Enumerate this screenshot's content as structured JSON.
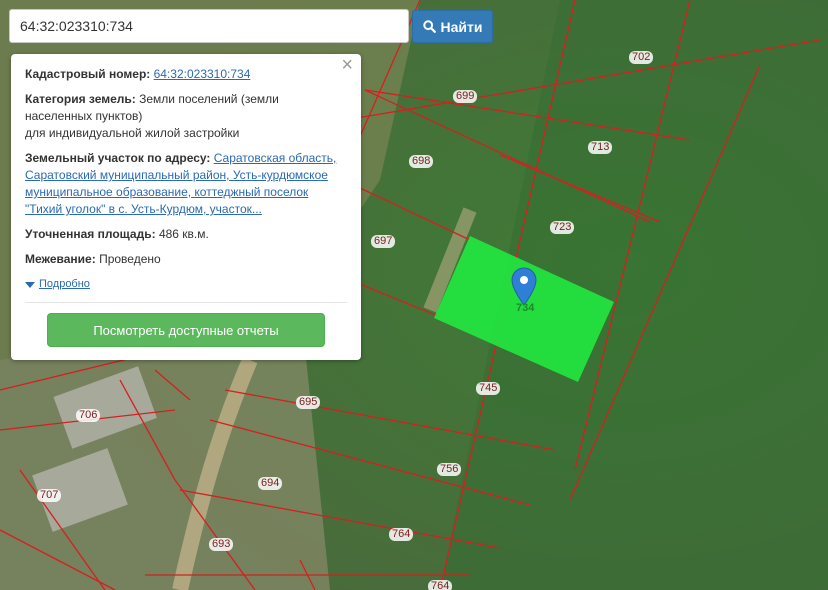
{
  "search": {
    "value": "64:32:023310:734",
    "button_label": "Найти"
  },
  "popup": {
    "cadastral_label": "Кадастровый номер:",
    "cadastral_value": "64:32:023310:734",
    "category_label": "Категория земель:",
    "category_value": "Земли поселений (земли населенных пунктов)",
    "category_sub": "для индивидуальной жилой застройки",
    "address_label": "Земельный участок по адресу:",
    "address_value": "Саратовская область, Саратовский муниципальный район, Усть-курдюмское муниципальное образование, коттеджный поселок \"Тихий уголок\" в с. Усть-Курдюм, участок...",
    "area_label": "Уточненная площадь:",
    "area_value": "486 кв.м.",
    "survey_label": "Межевание:",
    "survey_value": "Проведено",
    "details_link": "Подробно",
    "reports_button": "Посмотреть доступные отчеты",
    "close_symbol": "×"
  },
  "map": {
    "selected_plot": "734",
    "parcel_numbers": [
      "702",
      "699",
      "713",
      "698",
      "723",
      "697",
      "745",
      "706",
      "695",
      "756",
      "707",
      "694",
      "764",
      "693",
      "764"
    ],
    "colors": {
      "boundary": "#d42020",
      "selected_fill": "#22e640",
      "marker": "#2f7fd6"
    }
  }
}
